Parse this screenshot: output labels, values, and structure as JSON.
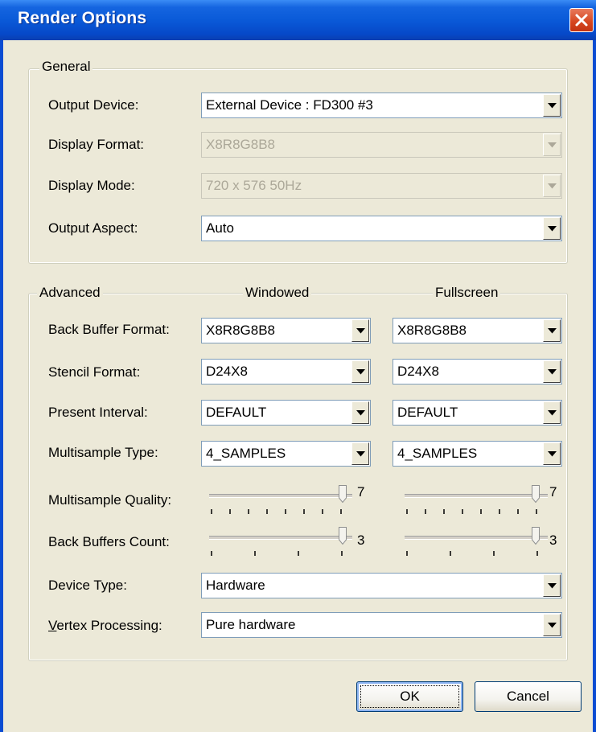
{
  "window": {
    "title": "Render Options"
  },
  "general": {
    "legend": "General",
    "output_device": {
      "label": "Output Device:",
      "value": "External Device : FD300 #3"
    },
    "display_format": {
      "label": "Display Format:",
      "value": "X8R8G8B8"
    },
    "display_mode": {
      "label": "Display Mode:",
      "value": "720 x 576  50Hz"
    },
    "output_aspect": {
      "label": "Output Aspect:",
      "value": "Auto"
    }
  },
  "advanced": {
    "legend": "Advanced",
    "col_windowed": "Windowed",
    "col_fullscreen": "Fullscreen",
    "back_buffer_format": {
      "label": "Back Buffer Format:",
      "windowed": "X8R8G8B8",
      "fullscreen": "X8R8G8B8"
    },
    "stencil_format": {
      "label": "Stencil Format:",
      "windowed": "D24X8",
      "fullscreen": "D24X8"
    },
    "present_interval": {
      "label": "Present Interval:",
      "windowed": "DEFAULT",
      "fullscreen": "DEFAULT"
    },
    "multisample_type": {
      "label": "Multisample Type:",
      "windowed": "4_SAMPLES",
      "fullscreen": "4_SAMPLES"
    },
    "multisample_quality": {
      "label": "Multisample Quality:",
      "windowed": "7",
      "fullscreen": "7"
    },
    "back_buffers_count": {
      "label": "Back Buffers Count:",
      "windowed": "3",
      "fullscreen": "3"
    },
    "device_type": {
      "label": "Device Type:",
      "value": "Hardware"
    },
    "vertex_processing": {
      "label_accel": "V",
      "label_rest": "ertex Processing:",
      "value": "Pure hardware"
    }
  },
  "buttons": {
    "ok": "OK",
    "cancel": "Cancel"
  },
  "icons": {
    "close": "close-icon",
    "dropdown": "chevron-down-icon",
    "slider_thumb": "slider-thumb-icon"
  },
  "colors": {
    "titlebar": "#0A5AD8",
    "face": "#ECE9D8",
    "field_border": "#7F9DB9",
    "disabled_text": "#ACA899"
  }
}
